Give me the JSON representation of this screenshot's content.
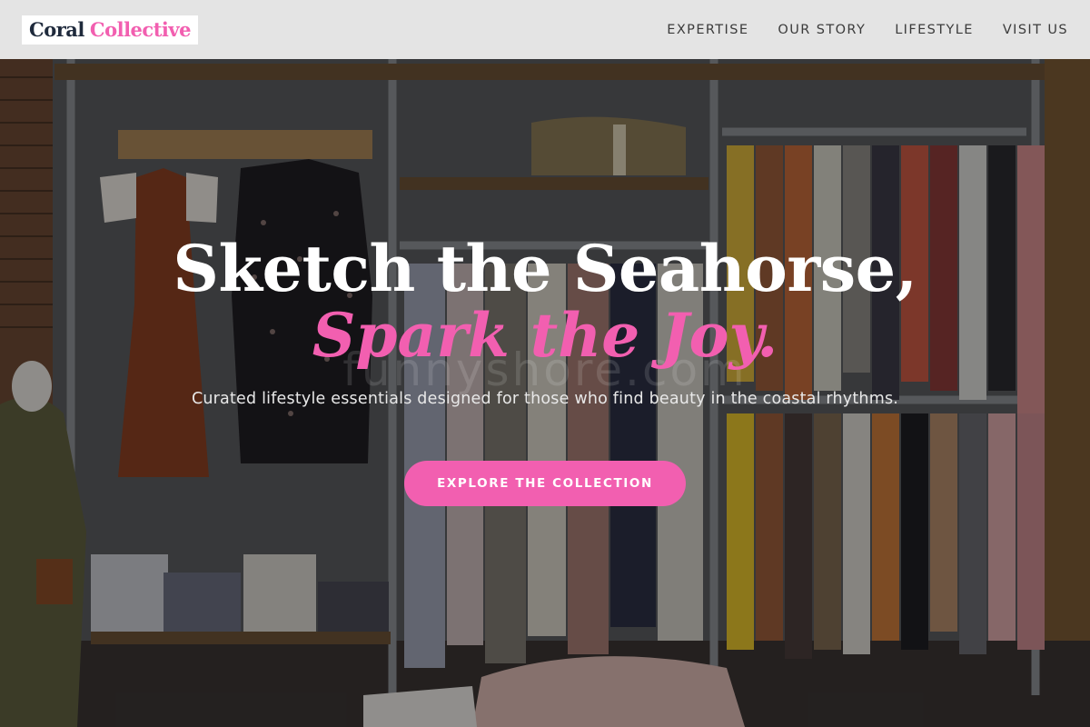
{
  "brand": {
    "word1": "Coral",
    "word2": "Collective"
  },
  "nav": {
    "items": [
      {
        "label": "EXPERTISE"
      },
      {
        "label": "OUR STORY"
      },
      {
        "label": "LIFESTYLE"
      },
      {
        "label": "VISIT US"
      }
    ]
  },
  "hero": {
    "headline": "Sketch the Seahorse,",
    "subheadline": "Spark the Joy.",
    "tagline": "Curated lifestyle essentials designed for those who find beauty in the coastal rhythms.",
    "cta_label": "EXPLORE THE COLLECTION",
    "watermark": "funnyshore.com",
    "background_image": "clothing-boutique-racks-photo"
  },
  "colors": {
    "accent": "#f25fb0",
    "logo_dark": "#1f2a3c",
    "nav_bg": "#ececec",
    "nav_text": "#3b3b3b",
    "headline": "#ffffff"
  }
}
